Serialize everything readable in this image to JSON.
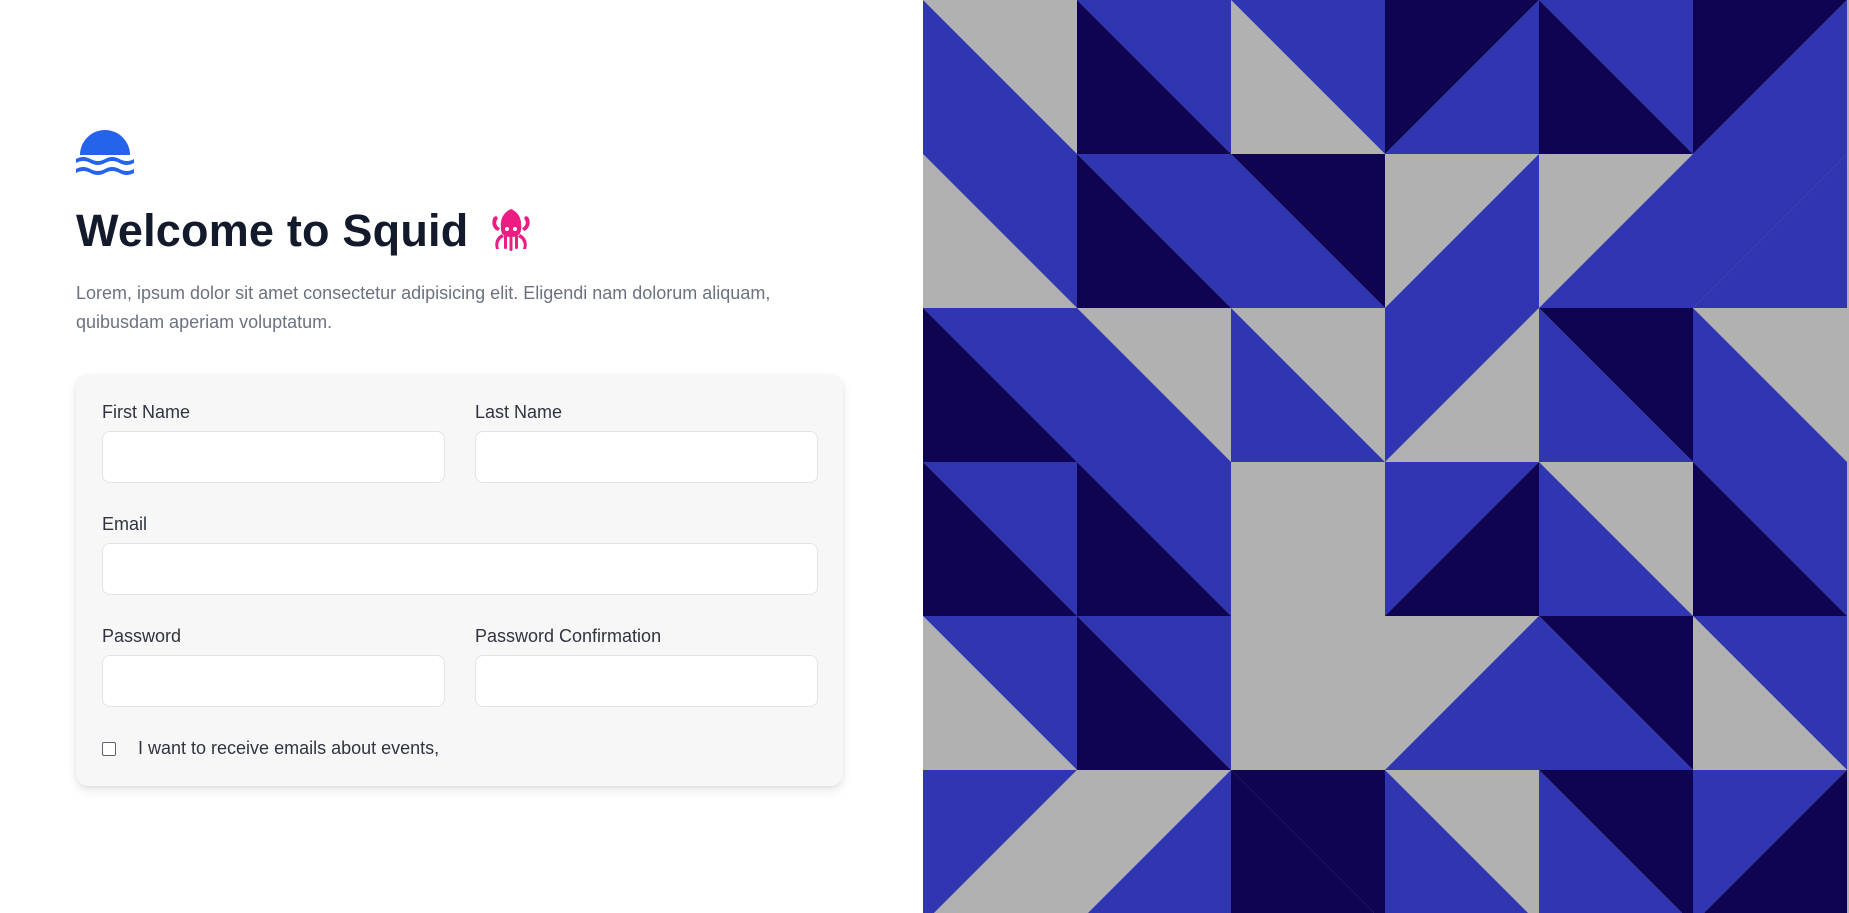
{
  "welcome": {
    "title": "Welcome to Squid",
    "subtitle": "Lorem, ipsum dolor sit amet consectetur adipisicing elit. Eligendi nam dolorum aliquam, quibusdam aperiam voluptatum."
  },
  "icons": {
    "logo": "waves-logo-icon",
    "title_emoji": "squid-icon",
    "brand_color": "#2563eb",
    "squid_color": "#ec1c83"
  },
  "form": {
    "first_name": {
      "label": "First Name",
      "value": ""
    },
    "last_name": {
      "label": "Last Name",
      "value": ""
    },
    "email": {
      "label": "Email",
      "value": ""
    },
    "password": {
      "label": "Password",
      "value": ""
    },
    "password_confirmation": {
      "label": "Password Confirmation",
      "value": ""
    },
    "newsletter": {
      "label": "I want to receive emails about events,",
      "checked": false
    }
  },
  "pattern": {
    "colors": {
      "blue": "#3035b1",
      "navy": "#0e0452",
      "gray": "#b1b1b1"
    }
  }
}
